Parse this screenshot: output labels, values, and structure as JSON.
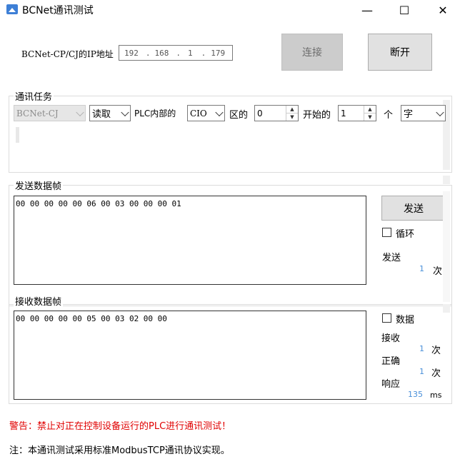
{
  "window": {
    "title": "BCNet通讯测试",
    "minimize": "—",
    "maximize": "☐",
    "close": "✕"
  },
  "connection": {
    "ip_label": "BCNet-CP/CJ的IP地址",
    "ip": [
      "192",
      "168",
      "1",
      "179"
    ],
    "ip_sep": ".",
    "connect_label": "连接",
    "disconnect_label": "断开"
  },
  "task": {
    "group_title": "通讯任务",
    "device": "BCNet-CJ",
    "operation": "读取",
    "plc_label": "PLC内部的",
    "area": "CIO",
    "area_suffix": "区的",
    "start_value": "0",
    "start_label": "开始的",
    "count_value": "1",
    "count_label": "个",
    "unit": "字"
  },
  "send": {
    "group_title": "发送数据帧",
    "frame": "00 00 00 00 00 06 00 03 00 00 00 01",
    "send_label": "发送",
    "loop_label": "循环",
    "sent_label": "发送",
    "sent_count": "1",
    "times_unit": "次"
  },
  "receive": {
    "group_title": "接收数据帧",
    "frame": "00 00 00 00 00 05 00 03 02 00 00",
    "data_label": "数据",
    "recv_label": "接收",
    "recv_count": "1",
    "correct_label": "正确",
    "correct_count": "1",
    "response_label": "响应",
    "response_ms": "135",
    "times_unit": "次",
    "ms_unit": "ms"
  },
  "footer": {
    "warning": "警告：禁止对正在控制设备运行的PLC进行通讯测试！",
    "note": "注：本通讯测试采用标准ModbusTCP通讯协议实现。"
  },
  "colors": {
    "warning": "#e00000",
    "count": "#4a90d9",
    "icon": "#3d7fd6"
  }
}
